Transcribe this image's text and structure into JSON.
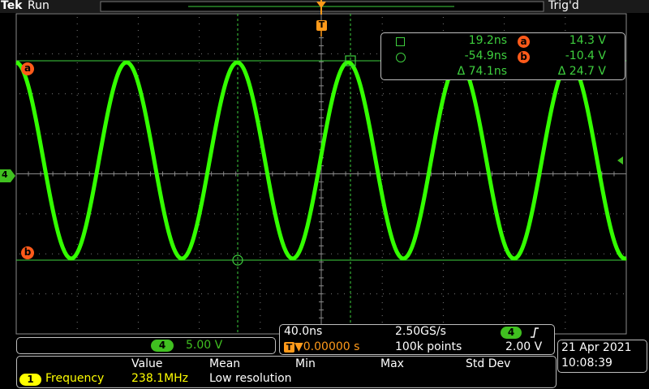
{
  "header": {
    "brand": "Tek",
    "run_state": "Run",
    "trigger_status": "Trig'd",
    "trigger_marker": "T"
  },
  "cursor_readout": {
    "time_a": "19.2ns",
    "time_b": "-54.9ns",
    "time_delta": "Δ 74.1ns",
    "volt_a_label": "a",
    "volt_a": "14.3 V",
    "volt_b_label": "b",
    "volt_b": "-10.4 V",
    "volt_delta": "Δ 24.7 V"
  },
  "markers": {
    "cursor_a": "a",
    "cursor_b": "b",
    "channel": "4"
  },
  "channel_scale": {
    "channel": "4",
    "volts_per_div": "5.00 V"
  },
  "timebase": {
    "time_per_div": "40.0ns",
    "sample_rate": "2.50GS/s",
    "trigger_position": "▼0.00000 s",
    "trigger_icon": "T",
    "record_length": "100k points",
    "trigger_channel": "4",
    "trigger_slope_icon": "rising-edge",
    "trigger_level": "2.00 V"
  },
  "datetime": {
    "date": "21 Apr 2021",
    "time": "10:08:39"
  },
  "measurements": {
    "headers": [
      "Value",
      "Mean",
      "Min",
      "Max",
      "Std Dev"
    ],
    "row": {
      "source": "1",
      "name": "Frequency",
      "value": "238.1MHz",
      "note": "Low resolution"
    }
  },
  "colors": {
    "waveform": "#33ff00",
    "cursor_line": "#3ecf3e",
    "grid": "#7a7a7a",
    "trigger_orange": "#ff9a1a",
    "channel4_green": "#40c020",
    "marker_red": "#ff5a1a",
    "meas_yellow": "#ffff00"
  }
}
